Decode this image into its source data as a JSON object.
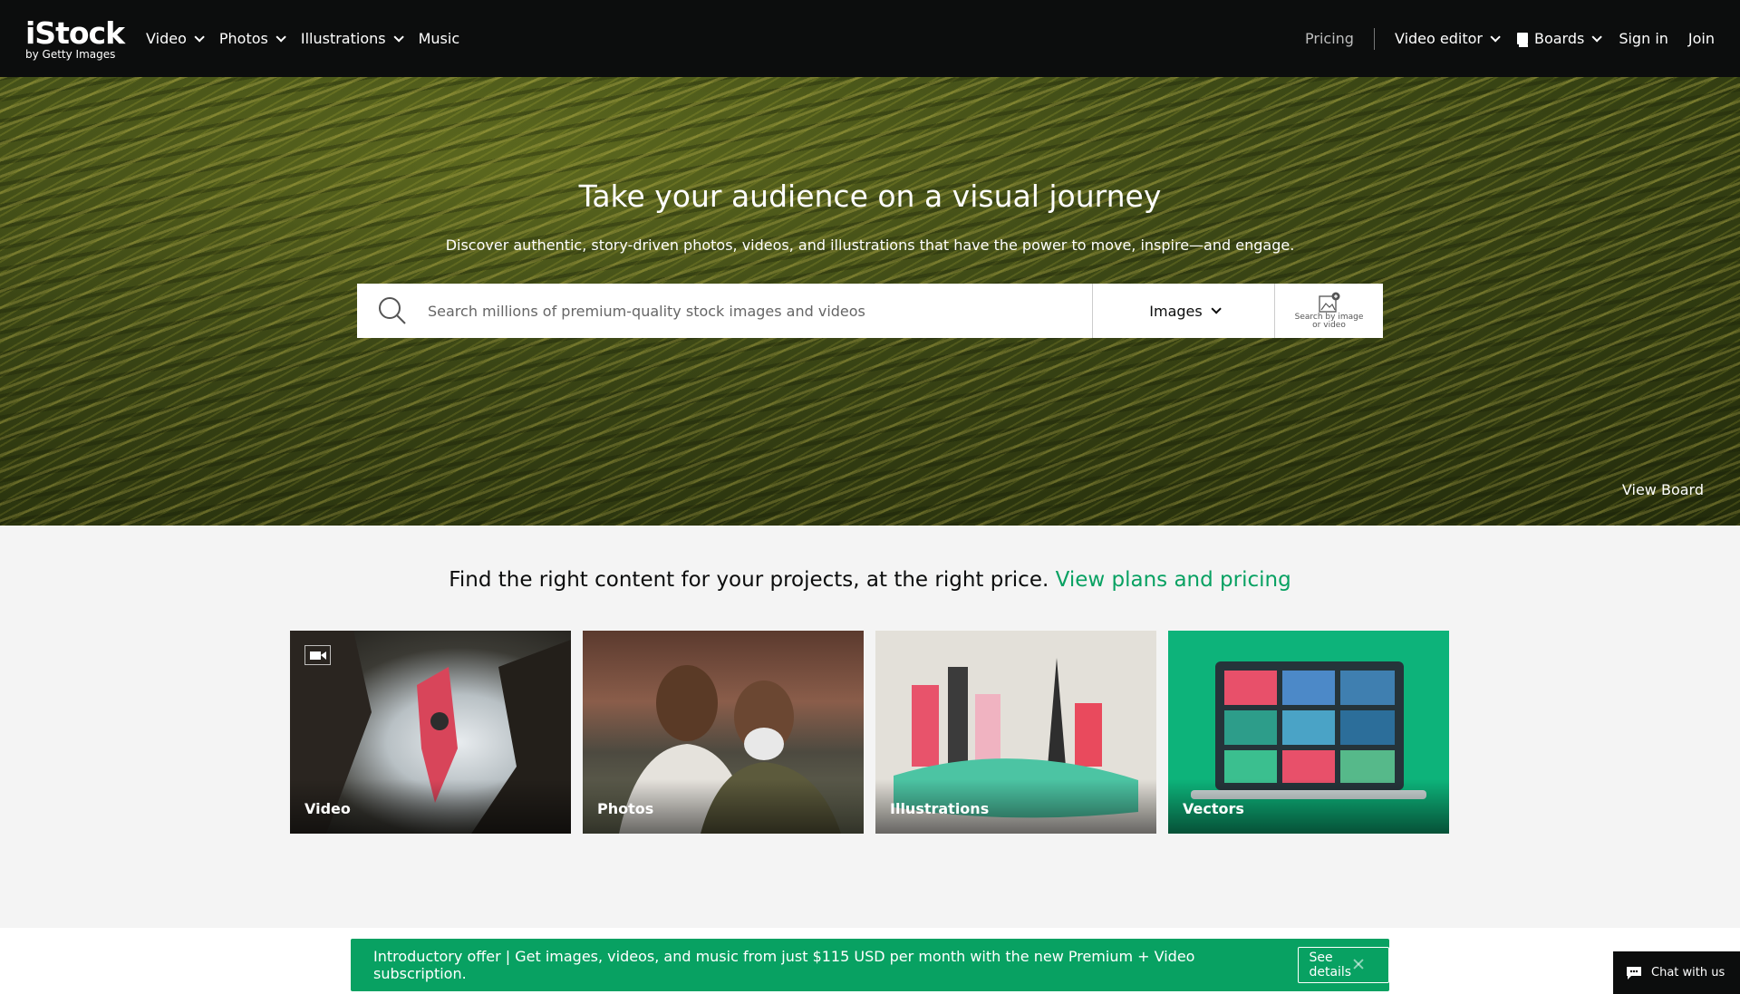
{
  "header": {
    "logo_brand": "iStock",
    "logo_sub": "by Getty Images",
    "nav": [
      {
        "label": "Video"
      },
      {
        "label": "Photos"
      },
      {
        "label": "Illustrations"
      },
      {
        "label": "Music"
      }
    ],
    "pricing": "Pricing",
    "video_editor": "Video editor",
    "boards": "Boards",
    "sign_in": "Sign in",
    "join": "Join"
  },
  "hero": {
    "title": "Take your audience on a visual journey",
    "subtitle": "Discover authentic, story-driven photos, videos, and illustrations that have the power to move, inspire—and engage.",
    "search": {
      "placeholder": "Search millions of premium-quality stock images and videos",
      "type_selected": "Images",
      "image_search_label_1": "Search by image",
      "image_search_label_2": "or video"
    },
    "view_board": "View Board"
  },
  "promo": {
    "text": "Find the right content for your projects, at the right price.",
    "link": "View plans and pricing"
  },
  "tiles": [
    {
      "label": "Video"
    },
    {
      "label": "Photos"
    },
    {
      "label": "Illustrations"
    },
    {
      "label": "Vectors"
    }
  ],
  "offer": {
    "text": "Introductory offer | Get images, videos, and music from just $115 USD per month with the new Premium + Video subscription.",
    "button": "See details"
  },
  "chat": {
    "label": "Chat with us"
  },
  "colors": {
    "accent": "#08a162",
    "header_bg": "#0c0d0d",
    "vectors_bg": "#0db37a"
  }
}
